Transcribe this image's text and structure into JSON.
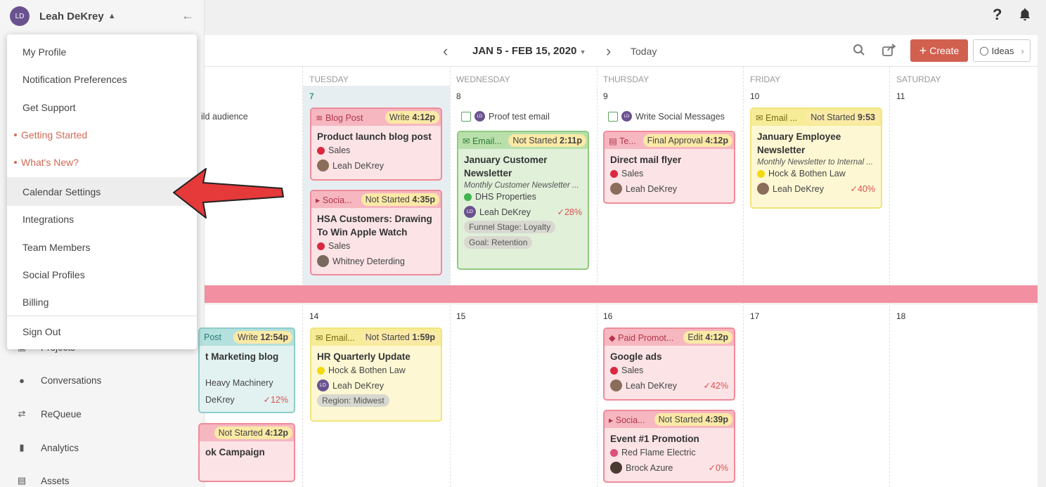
{
  "sidebar": {
    "user": {
      "initials": "LD",
      "name": "Leah DeKrey"
    },
    "nav": [
      {
        "label": "Projects",
        "icon": "folder-icon"
      },
      {
        "label": "Conversations",
        "icon": "chat-bubble-icon"
      },
      {
        "label": "ReQueue",
        "icon": "shuffle-icon"
      },
      {
        "label": "Analytics",
        "icon": "bar-chart-icon"
      },
      {
        "label": "Assets",
        "icon": "briefcase-icon"
      }
    ]
  },
  "dropdown": {
    "items": [
      {
        "label": "My Profile"
      },
      {
        "label": "Notification Preferences"
      },
      {
        "label": "Get Support"
      },
      {
        "label": "Getting Started"
      },
      {
        "label": "What's New?"
      },
      {
        "label": "Calendar Settings"
      },
      {
        "label": "Integrations"
      },
      {
        "label": "Team Members"
      },
      {
        "label": "Social Profiles"
      },
      {
        "label": "Billing"
      },
      {
        "label": "Sign Out"
      }
    ]
  },
  "toolbar": {
    "date_range": "JAN 5 - FEB 15, 2020",
    "today": "Today",
    "create": "Create",
    "ideas": "Ideas"
  },
  "calendar": {
    "days": [
      "TUESDAY",
      "WEDNESDAY",
      "THURSDAY",
      "FRIDAY",
      "SATURDAY"
    ],
    "week1_dates": [
      "7",
      "8",
      "9",
      "10",
      "11"
    ],
    "week2_dates": [
      "14",
      "15",
      "16",
      "17",
      "18"
    ],
    "partial_text": {
      "audience": "ild audience",
      "post": "Post",
      "marketing": "t Marketing blog",
      "heavy": "Heavy Machinery",
      "dekrey": "DeKrey",
      "pct12": "12%",
      "campaign": "ok Campaign"
    },
    "tasks": {
      "proof": {
        "initials": "LD",
        "label": "Proof test email"
      },
      "social": {
        "initials": "LD",
        "label": "Write Social Messages"
      }
    },
    "cards": {
      "blog": {
        "type": "Blog Post",
        "status": "Write",
        "time": "4:12p",
        "title": "Product launch blog post",
        "tag": "Sales",
        "person": "Leah DeKrey"
      },
      "hsa": {
        "type": "Socia...",
        "status": "Not Started",
        "time": "4:35p",
        "title": "HSA Customers: Drawing To Win Apple Watch",
        "tag": "Sales",
        "person": "Whitney Deterding"
      },
      "newsletter": {
        "type": "Email...",
        "status": "Not Started",
        "time": "2:11p",
        "title": "January Customer Newsletter",
        "subtitle": "Monthly Customer Newsletter ...",
        "tag": "DHS Properties",
        "person": "Leah DeKrey",
        "pct": "28%",
        "extra1": "Funnel Stage: Loyalty",
        "extra2": "Goal: Retention"
      },
      "flyer": {
        "type": "Te...",
        "status": "Final Approval",
        "time": "4:12p",
        "title": "Direct mail flyer",
        "tag": "Sales",
        "person": "Leah DeKrey"
      },
      "employee": {
        "type": "Email ...",
        "status": "Not Started",
        "time": "9:53",
        "title": "January Employee Newsletter",
        "subtitle": "Monthly Newsletter to Internal ...",
        "tag": "Hock & Bothen Law",
        "person": "Leah DeKrey",
        "pct": "40%"
      },
      "hr": {
        "type": "Email...",
        "status": "Not Started",
        "time": "1:59p",
        "title": "HR Quarterly Update",
        "tag": "Hock & Bothen Law",
        "person": "Leah DeKrey",
        "extra1": "Region: Midwest"
      },
      "ads": {
        "type": "Paid Promot...",
        "status": "Edit",
        "time": "4:12p",
        "title": "Google ads",
        "tag": "Sales",
        "person": "Leah DeKrey",
        "pct": "42%"
      },
      "event": {
        "type": "Socia...",
        "status": "Not Started",
        "time": "4:39p",
        "title": "Event #1 Promotion",
        "tag": "Red Flame Electric",
        "person": "Brock Azure",
        "pct": "0%"
      },
      "partial1": {
        "status": "Write",
        "time": "12:54p"
      },
      "partial2": {
        "status": "Not Started",
        "time": "4:12p"
      }
    }
  },
  "colors": {
    "accent": "#d1604f",
    "week_band": "#f28fa0"
  }
}
